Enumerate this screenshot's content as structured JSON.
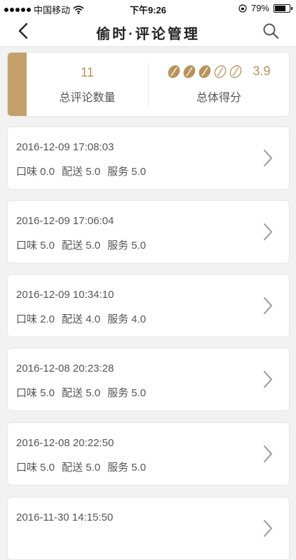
{
  "status": {
    "carrier": "中国移动",
    "time": "下午9:26",
    "battery": "79%"
  },
  "nav": {
    "title": "偷时·评论管理",
    "back_icon": "chevron-left-icon",
    "search_icon": "search-icon"
  },
  "summary": {
    "total_count": "11",
    "total_label": "总评论数量",
    "score": "3.9",
    "score_label": "总体得分",
    "rating_filled": 3,
    "rating_max": 5,
    "accent_color": "#c4a06a"
  },
  "reviews": [
    {
      "datetime": "2016-12-09 17:08:03",
      "taste": "口味 0.0",
      "delivery": "配送 5.0",
      "service": "服务 5.0"
    },
    {
      "datetime": "2016-12-09 17:06:04",
      "taste": "口味 5.0",
      "delivery": "配送 5.0",
      "service": "服务 5.0"
    },
    {
      "datetime": "2016-12-09 10:34:10",
      "taste": "口味 2.0",
      "delivery": "配送 4.0",
      "service": "服务 4.0"
    },
    {
      "datetime": "2016-12-08 20:23:28",
      "taste": "口味 5.0",
      "delivery": "配送 5.0",
      "service": "服务 5.0"
    },
    {
      "datetime": "2016-12-08 20:22:50",
      "taste": "口味 5.0",
      "delivery": "配送 5.0",
      "service": "服务 5.0"
    },
    {
      "datetime": "2016-11-30 14:15:50",
      "taste": "",
      "delivery": "",
      "service": ""
    }
  ]
}
